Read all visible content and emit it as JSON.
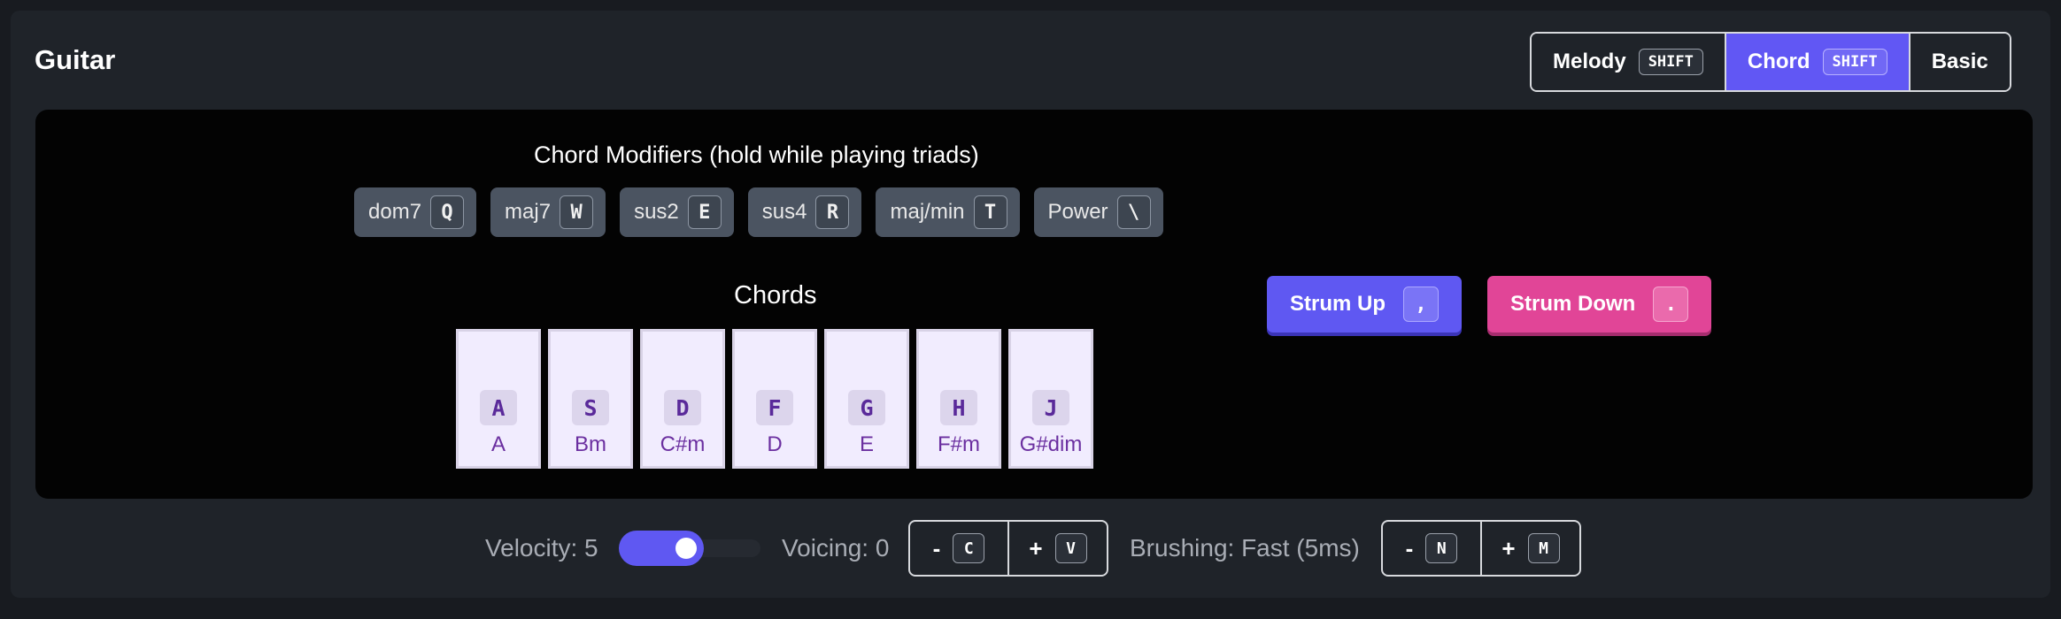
{
  "header": {
    "title": "Guitar",
    "modes": [
      {
        "label": "Melody",
        "key": "SHIFT",
        "active": false
      },
      {
        "label": "Chord",
        "key": "SHIFT",
        "active": true
      },
      {
        "label": "Basic",
        "key": "",
        "active": false
      }
    ]
  },
  "modifiers": {
    "title": "Chord Modifiers (hold while playing triads)",
    "items": [
      {
        "label": "dom7",
        "key": "Q"
      },
      {
        "label": "maj7",
        "key": "W"
      },
      {
        "label": "sus2",
        "key": "E"
      },
      {
        "label": "sus4",
        "key": "R"
      },
      {
        "label": "maj/min",
        "key": "T"
      },
      {
        "label": "Power",
        "key": "\\"
      }
    ]
  },
  "chords": {
    "title": "Chords",
    "keys": [
      {
        "key": "A",
        "chord": "A"
      },
      {
        "key": "S",
        "chord": "Bm"
      },
      {
        "key": "D",
        "chord": "C#m"
      },
      {
        "key": "F",
        "chord": "D"
      },
      {
        "key": "G",
        "chord": "E"
      },
      {
        "key": "H",
        "chord": "F#m"
      },
      {
        "key": "J",
        "chord": "G#dim"
      }
    ]
  },
  "strum": {
    "up": {
      "label": "Strum Up",
      "key": ","
    },
    "down": {
      "label": "Strum Down",
      "key": "."
    }
  },
  "controls": {
    "velocity_label": "Velocity: 5",
    "velocity_fraction": 0.45,
    "voicing_label": "Voicing: 0",
    "voicing_minus": {
      "symbol": "-",
      "key": "C"
    },
    "voicing_plus": {
      "symbol": "+",
      "key": "V"
    },
    "brushing_label": "Brushing: Fast (5ms)",
    "brushing_minus": {
      "symbol": "-",
      "key": "N"
    },
    "brushing_plus": {
      "symbol": "+",
      "key": "M"
    }
  },
  "colors": {
    "accent": "#5f58f2",
    "strum_down": "#e14597",
    "key_bg": "#f1ecfe",
    "key_text": "#6b2fa0"
  }
}
